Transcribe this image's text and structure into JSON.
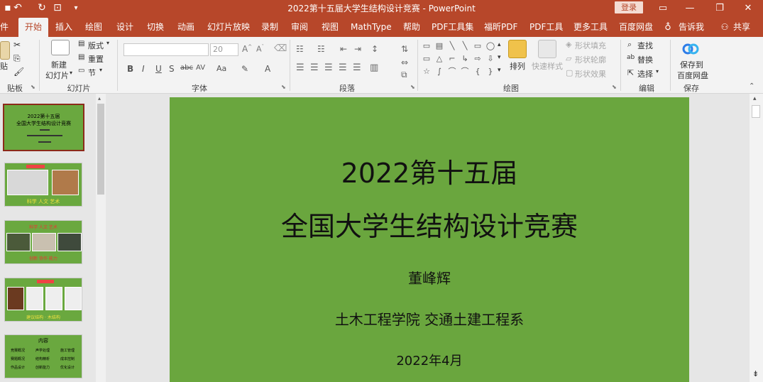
{
  "titlebar": {
    "title": "2022第十五届大学生结构设计竞赛 - PowerPoint",
    "login": "登录",
    "icons": [
      "save-icon",
      "undo-icon",
      "redo-icon",
      "present-icon",
      "customize-icon"
    ]
  },
  "tabs": [
    {
      "label": "件"
    },
    {
      "label": "开始"
    },
    {
      "label": "插入"
    },
    {
      "label": "绘图"
    },
    {
      "label": "设计"
    },
    {
      "label": "切换"
    },
    {
      "label": "动画"
    },
    {
      "label": "幻灯片放映"
    },
    {
      "label": "录制"
    },
    {
      "label": "审阅"
    },
    {
      "label": "视图"
    },
    {
      "label": "MathType"
    },
    {
      "label": "帮助"
    },
    {
      "label": "PDF工具集"
    },
    {
      "label": "福昕PDF"
    },
    {
      "label": "PDF工具"
    },
    {
      "label": "更多工具"
    },
    {
      "label": "百度网盘"
    },
    {
      "label": "告诉我"
    },
    {
      "label": "共享"
    }
  ],
  "ribbon": {
    "clipboard": {
      "paste": "贴",
      "label": "贴板"
    },
    "slides": {
      "new_line1": "新建",
      "new_line2": "幻灯片",
      "layout": "版式",
      "reset": "重置",
      "section": "节",
      "label": "幻灯片"
    },
    "font": {
      "label": "字体",
      "font_name": "",
      "font_size": "20"
    },
    "paragraph": {
      "label": "段落"
    },
    "drawing": {
      "arrange": "排列",
      "quick_styles": "快速样式",
      "fill": "形状填充",
      "outline": "形状轮廓",
      "effects": "形状效果",
      "label": "绘图"
    },
    "editing": {
      "find": "查找",
      "replace": "替换",
      "select": "选择",
      "label": "编辑"
    },
    "save": {
      "line1": "保存到",
      "line2": "百度网盘",
      "label": "保存"
    }
  },
  "thumbnails": [
    {
      "title1": "2022第十五届",
      "title2": "全国大学生结构设计竞赛"
    },
    {
      "caption": "科学 人文 艺术"
    },
    {
      "top": "科学 人文 艺术",
      "caption": "创新 协作 能力"
    },
    {
      "caption": "建议结构 · 木结构"
    },
    {
      "title": "内容",
      "items": [
        "竞赛概况",
        "赛题概况",
        "作品设计",
        "声学处理",
        "结构精析",
        "创新能力",
        "施工管理",
        "成本控制",
        "优化设计"
      ]
    }
  ],
  "slide": {
    "title_line1": "2022第十五届",
    "title_line2": "全国大学生结构设计竞赛",
    "author": "董峰辉",
    "department": "土木工程学院 交通土建工程系",
    "date": "2022年4月"
  },
  "colors": {
    "accent": "#b7472a",
    "slide_bg": "#6aa63e"
  }
}
